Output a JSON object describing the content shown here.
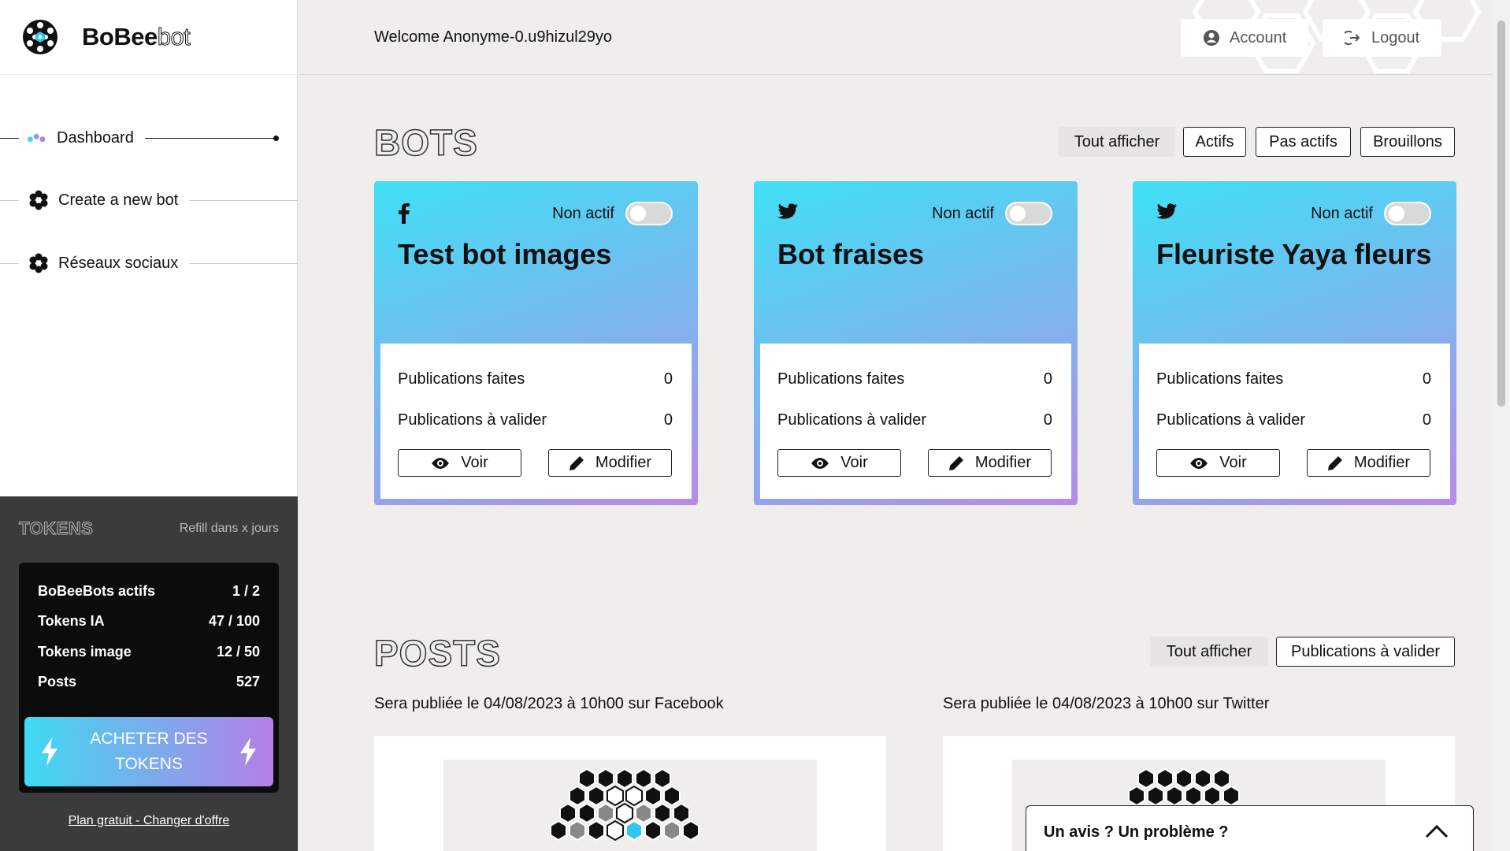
{
  "app": {
    "brand_primary": "BoBee",
    "brand_secondary": "bot"
  },
  "sidebar": {
    "items": [
      {
        "label": "Dashboard",
        "icon": "dots-icon",
        "active": true
      },
      {
        "label": "Create a new bot",
        "icon": "hex-flower-icon",
        "active": false
      },
      {
        "label": "Réseaux sociaux",
        "icon": "hex-flower-icon",
        "active": false
      }
    ]
  },
  "tokens": {
    "title": "TOKENS",
    "refill": "Refill dans x jours",
    "rows": [
      {
        "label": "BoBeeBots actifs",
        "value": "1 / 2"
      },
      {
        "label": "Tokens IA",
        "value": "47 / 100"
      },
      {
        "label": "Tokens image",
        "value": "12 / 50"
      },
      {
        "label": "Posts",
        "value": "527"
      }
    ],
    "buy_line1": "ACHETER DES",
    "buy_line2": "TOKENS",
    "plan_link": "Plan gratuit - Changer d'offre"
  },
  "header": {
    "welcome": "Welcome Anonyme-0.u9hizul29yo",
    "account_label": "Account",
    "logout_label": "Logout"
  },
  "bots": {
    "title": "BOTS",
    "filters": [
      "Tout afficher",
      "Actifs",
      "Pas actifs",
      "Brouillons"
    ],
    "selected_filter": "Tout afficher",
    "cards": [
      {
        "network_icon": "facebook-icon",
        "status": "Non actif",
        "active": false,
        "name": "Test bot images",
        "published_label": "Publications faites",
        "published": "0",
        "pending_label": "Publications à valider",
        "pending": "0",
        "view_label": "Voir",
        "edit_label": "Modifier"
      },
      {
        "network_icon": "twitter-icon",
        "status": "Non actif",
        "active": false,
        "name": "Bot fraises",
        "published_label": "Publications faites",
        "published": "0",
        "pending_label": "Publications à valider",
        "pending": "0",
        "view_label": "Voir",
        "edit_label": "Modifier"
      },
      {
        "network_icon": "twitter-icon",
        "status": "Non actif",
        "active": false,
        "name": "Fleuriste Yaya fleurs",
        "published_label": "Publications faites",
        "published": "0",
        "pending_label": "Publications à valider",
        "pending": "0",
        "view_label": "Voir",
        "edit_label": "Modifier"
      }
    ]
  },
  "posts": {
    "title": "POSTS",
    "filters": [
      "Tout afficher",
      "Publications à valider"
    ],
    "selected_filter": "Tout afficher",
    "items": [
      {
        "caption": "Sera publiée le 04/08/2023 à 10h00 sur Facebook"
      },
      {
        "caption": "Sera publiée le 04/08/2023 à 10h00 sur Twitter"
      }
    ]
  },
  "feedback": {
    "label": "Un avis ? Un problème ?"
  },
  "colors": {
    "gradient_start": "#3fe0f5",
    "gradient_end": "#b88be6",
    "background": "#efeeed",
    "dark_panel": "#3b3b3b"
  }
}
